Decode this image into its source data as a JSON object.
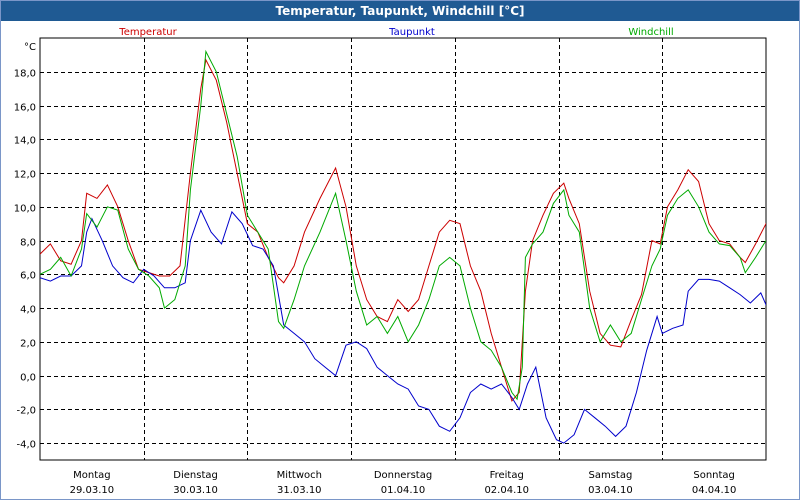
{
  "window": {
    "title": "Temperatur, Taupunkt, Windchill [°C]"
  },
  "chart_data": {
    "type": "line",
    "title": "Temperatur, Taupunkt, Windchill [°C]",
    "ylabel": "°C",
    "ylim": [
      -5,
      20
    ],
    "yticks": [
      -4,
      -2,
      0,
      2,
      4,
      6,
      8,
      10,
      12,
      14,
      16,
      18
    ],
    "ytick_labels": [
      "-4,0",
      "-2,0",
      "0,0",
      "2,0",
      "4,0",
      "6,0",
      "8,0",
      "10,0",
      "12,0",
      "14,0",
      "16,0",
      "18,0"
    ],
    "xlim": [
      0,
      7
    ],
    "grid": true,
    "legend_position": "top",
    "x_labels": [
      {
        "day": "Montag",
        "date": "29.03.10"
      },
      {
        "day": "Dienstag",
        "date": "30.03.10"
      },
      {
        "day": "Mittwoch",
        "date": "31.03.10"
      },
      {
        "day": "Donnerstag",
        "date": "01.04.10"
      },
      {
        "day": "Freitag",
        "date": "02.04.10"
      },
      {
        "day": "Samstag",
        "date": "03.04.10"
      },
      {
        "day": "Sonntag",
        "date": "04.04.10"
      }
    ],
    "series": [
      {
        "name": "Temperatur",
        "color": "#cc0000",
        "points": [
          [
            0,
            7.2
          ],
          [
            0.1,
            7.8
          ],
          [
            0.2,
            6.8
          ],
          [
            0.3,
            6.6
          ],
          [
            0.4,
            8
          ],
          [
            0.45,
            10.8
          ],
          [
            0.55,
            10.5
          ],
          [
            0.65,
            11.3
          ],
          [
            0.75,
            10
          ],
          [
            0.85,
            8
          ],
          [
            0.95,
            6.3
          ],
          [
            1.05,
            6.1
          ],
          [
            1.15,
            5.9
          ],
          [
            1.25,
            5.9
          ],
          [
            1.35,
            6.5
          ],
          [
            1.45,
            12
          ],
          [
            1.55,
            17
          ],
          [
            1.6,
            18.7
          ],
          [
            1.7,
            17.5
          ],
          [
            1.8,
            15
          ],
          [
            1.9,
            12
          ],
          [
            2.0,
            9
          ],
          [
            2.1,
            8.5
          ],
          [
            2.2,
            7
          ],
          [
            2.3,
            5.8
          ],
          [
            2.35,
            5.5
          ],
          [
            2.45,
            6.5
          ],
          [
            2.55,
            8.5
          ],
          [
            2.7,
            10.5
          ],
          [
            2.85,
            12.3
          ],
          [
            2.95,
            10
          ],
          [
            3.05,
            6.5
          ],
          [
            3.15,
            4.5
          ],
          [
            3.25,
            3.5
          ],
          [
            3.35,
            3.2
          ],
          [
            3.45,
            4.5
          ],
          [
            3.55,
            3.8
          ],
          [
            3.65,
            4.5
          ],
          [
            3.75,
            6.5
          ],
          [
            3.85,
            8.5
          ],
          [
            3.95,
            9.2
          ],
          [
            4.05,
            9.0
          ],
          [
            4.15,
            6.5
          ],
          [
            4.25,
            5
          ],
          [
            4.35,
            2.5
          ],
          [
            4.45,
            0.5
          ],
          [
            4.55,
            -1.5
          ],
          [
            4.62,
            -1.0
          ],
          [
            4.68,
            5
          ],
          [
            4.75,
            8
          ],
          [
            4.85,
            9.5
          ],
          [
            4.95,
            10.8
          ],
          [
            5.05,
            11.4
          ],
          [
            5.1,
            10.5
          ],
          [
            5.2,
            9
          ],
          [
            5.3,
            5
          ],
          [
            5.4,
            2.5
          ],
          [
            5.5,
            1.8
          ],
          [
            5.6,
            1.7
          ],
          [
            5.7,
            3.3
          ],
          [
            5.8,
            4.8
          ],
          [
            5.9,
            8
          ],
          [
            5.98,
            7.8
          ],
          [
            6.05,
            10
          ],
          [
            6.15,
            11
          ],
          [
            6.25,
            12.2
          ],
          [
            6.35,
            11.5
          ],
          [
            6.45,
            9
          ],
          [
            6.55,
            8
          ],
          [
            6.65,
            7.8
          ],
          [
            6.75,
            7.0
          ],
          [
            6.8,
            6.7
          ],
          [
            6.9,
            7.8
          ],
          [
            7.0,
            9.0
          ],
          [
            7.1,
            10.5
          ],
          [
            7.2,
            11.0
          ],
          [
            7.3,
            12
          ]
        ]
      },
      {
        "name": "Taupunkt",
        "color": "#0000cc",
        "points": [
          [
            0,
            5.8
          ],
          [
            0.1,
            5.6
          ],
          [
            0.2,
            5.9
          ],
          [
            0.3,
            5.9
          ],
          [
            0.4,
            6.5
          ],
          [
            0.45,
            8.5
          ],
          [
            0.5,
            9.3
          ],
          [
            0.6,
            8
          ],
          [
            0.7,
            6.5
          ],
          [
            0.8,
            5.8
          ],
          [
            0.9,
            5.5
          ],
          [
            1.0,
            6.3
          ],
          [
            1.1,
            5.9
          ],
          [
            1.2,
            5.2
          ],
          [
            1.3,
            5.2
          ],
          [
            1.4,
            5.5
          ],
          [
            1.45,
            8.0
          ],
          [
            1.55,
            9.8
          ],
          [
            1.65,
            8.5
          ],
          [
            1.75,
            7.8
          ],
          [
            1.85,
            9.7
          ],
          [
            1.95,
            9.0
          ],
          [
            2.05,
            7.7
          ],
          [
            2.15,
            7.5
          ],
          [
            2.25,
            6.5
          ],
          [
            2.35,
            3
          ],
          [
            2.45,
            2.5
          ],
          [
            2.55,
            2
          ],
          [
            2.65,
            1
          ],
          [
            2.75,
            0.5
          ],
          [
            2.85,
            0
          ],
          [
            2.95,
            1.8
          ],
          [
            3.05,
            2.0
          ],
          [
            3.15,
            1.6
          ],
          [
            3.25,
            0.5
          ],
          [
            3.35,
            0
          ],
          [
            3.45,
            -0.5
          ],
          [
            3.55,
            -0.8
          ],
          [
            3.65,
            -1.8
          ],
          [
            3.75,
            -2.0
          ],
          [
            3.85,
            -3.0
          ],
          [
            3.95,
            -3.3
          ],
          [
            4.05,
            -2.5
          ],
          [
            4.15,
            -1.0
          ],
          [
            4.25,
            -0.5
          ],
          [
            4.35,
            -0.8
          ],
          [
            4.45,
            -0.5
          ],
          [
            4.55,
            -1.3
          ],
          [
            4.62,
            -2.0
          ],
          [
            4.7,
            -0.5
          ],
          [
            4.78,
            0.5
          ],
          [
            4.88,
            -2.5
          ],
          [
            4.98,
            -3.8
          ],
          [
            5.05,
            -4.0
          ],
          [
            5.15,
            -3.5
          ],
          [
            5.25,
            -2.0
          ],
          [
            5.35,
            -2.5
          ],
          [
            5.45,
            -3.0
          ],
          [
            5.55,
            -3.6
          ],
          [
            5.65,
            -3.0
          ],
          [
            5.75,
            -1.0
          ],
          [
            5.85,
            1.5
          ],
          [
            5.95,
            3.5
          ],
          [
            6.0,
            2.5
          ],
          [
            6.1,
            2.8
          ],
          [
            6.2,
            3.0
          ],
          [
            6.25,
            5.0
          ],
          [
            6.35,
            5.7
          ],
          [
            6.45,
            5.7
          ],
          [
            6.55,
            5.6
          ],
          [
            6.65,
            5.2
          ],
          [
            6.75,
            4.8
          ],
          [
            6.85,
            4.3
          ],
          [
            6.95,
            4.9
          ],
          [
            7.05,
            3.5
          ],
          [
            7.15,
            2.5
          ],
          [
            7.25,
            2.5
          ]
        ]
      },
      {
        "name": "Windchill",
        "color": "#00aa00",
        "points": [
          [
            0,
            6
          ],
          [
            0.1,
            6.3
          ],
          [
            0.2,
            7
          ],
          [
            0.3,
            5.9
          ],
          [
            0.4,
            7.5
          ],
          [
            0.45,
            9.6
          ],
          [
            0.55,
            8.8
          ],
          [
            0.65,
            10
          ],
          [
            0.75,
            9.8
          ],
          [
            0.85,
            7.5
          ],
          [
            0.95,
            6.3
          ],
          [
            1.05,
            5.9
          ],
          [
            1.15,
            5.2
          ],
          [
            1.2,
            4.0
          ],
          [
            1.3,
            4.5
          ],
          [
            1.4,
            6.5
          ],
          [
            1.45,
            11
          ],
          [
            1.55,
            16
          ],
          [
            1.6,
            19.2
          ],
          [
            1.7,
            18
          ],
          [
            1.8,
            15.5
          ],
          [
            1.9,
            13
          ],
          [
            2.0,
            9.5
          ],
          [
            2.1,
            8.5
          ],
          [
            2.2,
            7.5
          ],
          [
            2.3,
            3.2
          ],
          [
            2.35,
            2.8
          ],
          [
            2.45,
            4.5
          ],
          [
            2.55,
            6.5
          ],
          [
            2.7,
            8.5
          ],
          [
            2.85,
            10.8
          ],
          [
            2.95,
            8
          ],
          [
            3.05,
            5
          ],
          [
            3.15,
            3
          ],
          [
            3.25,
            3.5
          ],
          [
            3.35,
            2.5
          ],
          [
            3.45,
            3.5
          ],
          [
            3.55,
            2.0
          ],
          [
            3.65,
            3.0
          ],
          [
            3.75,
            4.5
          ],
          [
            3.85,
            6.5
          ],
          [
            3.95,
            7.0
          ],
          [
            4.05,
            6.5
          ],
          [
            4.15,
            4.0
          ],
          [
            4.25,
            2.0
          ],
          [
            4.35,
            1.5
          ],
          [
            4.45,
            0.5
          ],
          [
            4.55,
            -1.0
          ],
          [
            4.6,
            -1.4
          ],
          [
            4.65,
            0.5
          ],
          [
            4.68,
            7.0
          ],
          [
            4.75,
            7.8
          ],
          [
            4.85,
            8.5
          ],
          [
            4.95,
            10.2
          ],
          [
            5.05,
            11.0
          ],
          [
            5.1,
            9.5
          ],
          [
            5.2,
            8.5
          ],
          [
            5.3,
            4.0
          ],
          [
            5.4,
            2.0
          ],
          [
            5.5,
            3.0
          ],
          [
            5.6,
            2.0
          ],
          [
            5.7,
            2.5
          ],
          [
            5.8,
            4.5
          ],
          [
            5.9,
            6.5
          ],
          [
            5.98,
            7.5
          ],
          [
            6.05,
            9.5
          ],
          [
            6.15,
            10.5
          ],
          [
            6.25,
            11.0
          ],
          [
            6.35,
            10.0
          ],
          [
            6.45,
            8.5
          ],
          [
            6.55,
            7.8
          ],
          [
            6.65,
            7.7
          ],
          [
            6.75,
            7.0
          ],
          [
            6.8,
            6.1
          ],
          [
            6.9,
            7.0
          ],
          [
            7.0,
            8.0
          ],
          [
            7.1,
            9.0
          ],
          [
            7.2,
            9.8
          ],
          [
            7.3,
            10.0
          ]
        ]
      }
    ]
  }
}
